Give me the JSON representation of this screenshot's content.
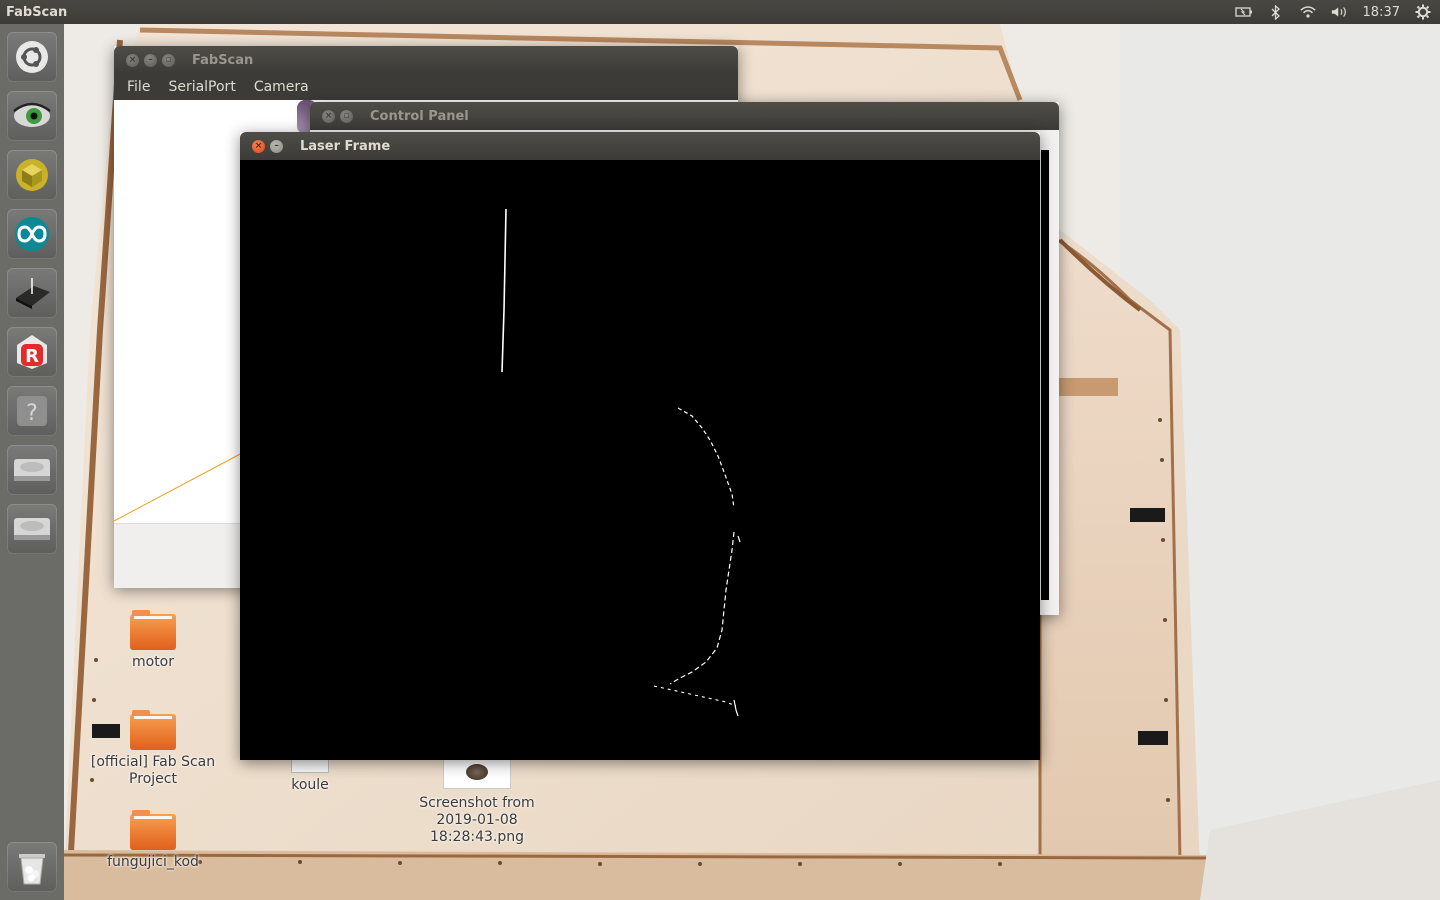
{
  "top_panel": {
    "app_name": "FabScan",
    "clock": "18:37",
    "indicators": [
      "battery-icon",
      "bluetooth-icon",
      "wifi-icon",
      "volume-icon",
      "gear-icon"
    ]
  },
  "launcher": {
    "items": [
      {
        "icon": "ubuntu-logo-icon"
      },
      {
        "icon": "eye-app-icon"
      },
      {
        "icon": "3d-cube-app-icon"
      },
      {
        "icon": "arduino-icon"
      },
      {
        "icon": "laser-scanner-icon"
      },
      {
        "icon": "r-app-icon"
      },
      {
        "icon": "help-icon"
      },
      {
        "icon": "drive-icon"
      },
      {
        "icon": "drive-icon"
      },
      {
        "icon": "trash-icon"
      }
    ]
  },
  "desktop": {
    "icons": [
      {
        "label": "motor",
        "type": "folder"
      },
      {
        "label": "[official] Fab Scan Project",
        "type": "folder"
      },
      {
        "label": "fungujici_kod",
        "type": "folder"
      },
      {
        "label": "koule",
        "type": "file"
      },
      {
        "label": "Screenshot from 2019-01-08 18:28:43.png",
        "type": "image"
      }
    ]
  },
  "windows": {
    "fabscan": {
      "title": "FabScan",
      "menu": [
        "File",
        "SerialPort",
        "Camera"
      ]
    },
    "control_panel": {
      "title": "Control Panel"
    },
    "laser_frame": {
      "title": "Laser Frame"
    }
  }
}
